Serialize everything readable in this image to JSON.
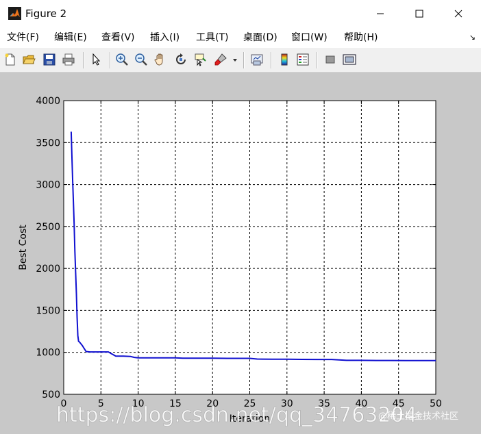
{
  "window": {
    "title": "Figure 2",
    "minimize_glyph": "—",
    "maximize_glyph": "☐",
    "close_glyph": "✕"
  },
  "menu": {
    "items": [
      {
        "label": "文件(F)"
      },
      {
        "label": "编辑(E)"
      },
      {
        "label": "查看(V)"
      },
      {
        "label": "插入(I)"
      },
      {
        "label": "工具(T)"
      },
      {
        "label": "桌面(D)"
      },
      {
        "label": "窗口(W)"
      },
      {
        "label": "帮助(H)"
      }
    ],
    "dock_glyph": "↘"
  },
  "toolbar": {
    "icons": [
      "new-figure-icon",
      "open-file-icon",
      "save-icon",
      "print-icon",
      "edit-plot-arrow-icon",
      "zoom-in-icon",
      "zoom-out-icon",
      "pan-hand-icon",
      "rotate-3d-icon",
      "data-cursor-icon",
      "brush-icon",
      "brush-dropdown-icon",
      "link-plot-icon",
      "insert-colorbar-icon",
      "insert-legend-icon",
      "hide-plot-tools-icon",
      "show-plot-tools-icon"
    ]
  },
  "watermark": {
    "url_text": "https://blog.csdn.net/qq_34763204",
    "juejin_text": "@稀土掘金技术社区"
  },
  "colors": {
    "line": "#1010d0",
    "figure_bg": "#c8c8c8",
    "axes_bg": "#ffffff"
  },
  "chart_data": {
    "type": "line",
    "title": "",
    "xlabel": "Iteration",
    "ylabel": "Best Cost",
    "xlim": [
      0,
      50
    ],
    "ylim": [
      500,
      4000
    ],
    "xticks": [
      0,
      5,
      10,
      15,
      20,
      25,
      30,
      35,
      40,
      45,
      50
    ],
    "yticks": [
      500,
      1000,
      1500,
      2000,
      2500,
      3000,
      3500,
      4000
    ],
    "grid": true,
    "grid_style": "dashed",
    "series": [
      {
        "x": [
          1,
          1.1,
          1.2,
          1.3,
          1.4,
          1.5,
          1.6,
          1.7,
          1.8,
          1.9,
          2,
          2.1,
          2.5,
          3,
          3.5,
          4,
          5,
          6,
          6.5,
          7,
          8,
          9,
          9.5,
          10,
          12,
          14,
          15,
          16,
          18,
          20,
          22,
          24,
          25,
          26,
          28,
          30,
          32,
          34,
          36,
          37,
          38,
          40,
          42,
          44,
          46,
          48,
          50
        ],
        "y": [
          3630,
          3350,
          3060,
          2800,
          2530,
          2200,
          1950,
          1700,
          1420,
          1200,
          1130,
          1125,
          1080,
          1010,
          1005,
          1005,
          1005,
          1005,
          980,
          955,
          955,
          950,
          940,
          935,
          935,
          935,
          935,
          930,
          930,
          930,
          928,
          928,
          928,
          920,
          918,
          918,
          916,
          915,
          915,
          910,
          905,
          905,
          903,
          903,
          902,
          902,
          902
        ]
      }
    ]
  }
}
